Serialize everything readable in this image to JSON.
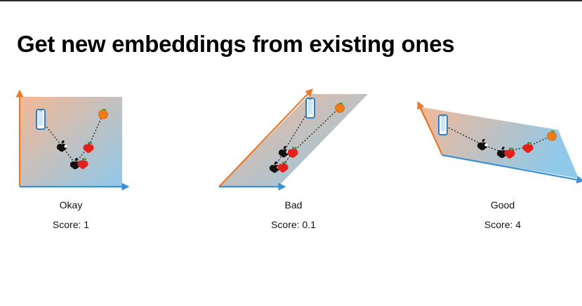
{
  "title": "Get new embeddings from existing ones",
  "panels": [
    {
      "label": "Okay",
      "score": "Score: 1"
    },
    {
      "label": "Bad",
      "score": "Score: 0.1"
    },
    {
      "label": "Good",
      "score": "Score: 4"
    }
  ],
  "colors": {
    "axis_vertical": "#e8792a",
    "axis_horizontal": "#3b8fd9",
    "gradient_warm": "#f4b896",
    "gradient_cool": "#8fc9ea",
    "phone": "#2f7fc8",
    "apple_red": "#e3201b",
    "orange_fruit": "#f07a13",
    "apple_logo": "#111111"
  },
  "icons": [
    "phone-icon",
    "apple-logo-icon",
    "red-apple-icon",
    "orange-fruit-icon"
  ]
}
